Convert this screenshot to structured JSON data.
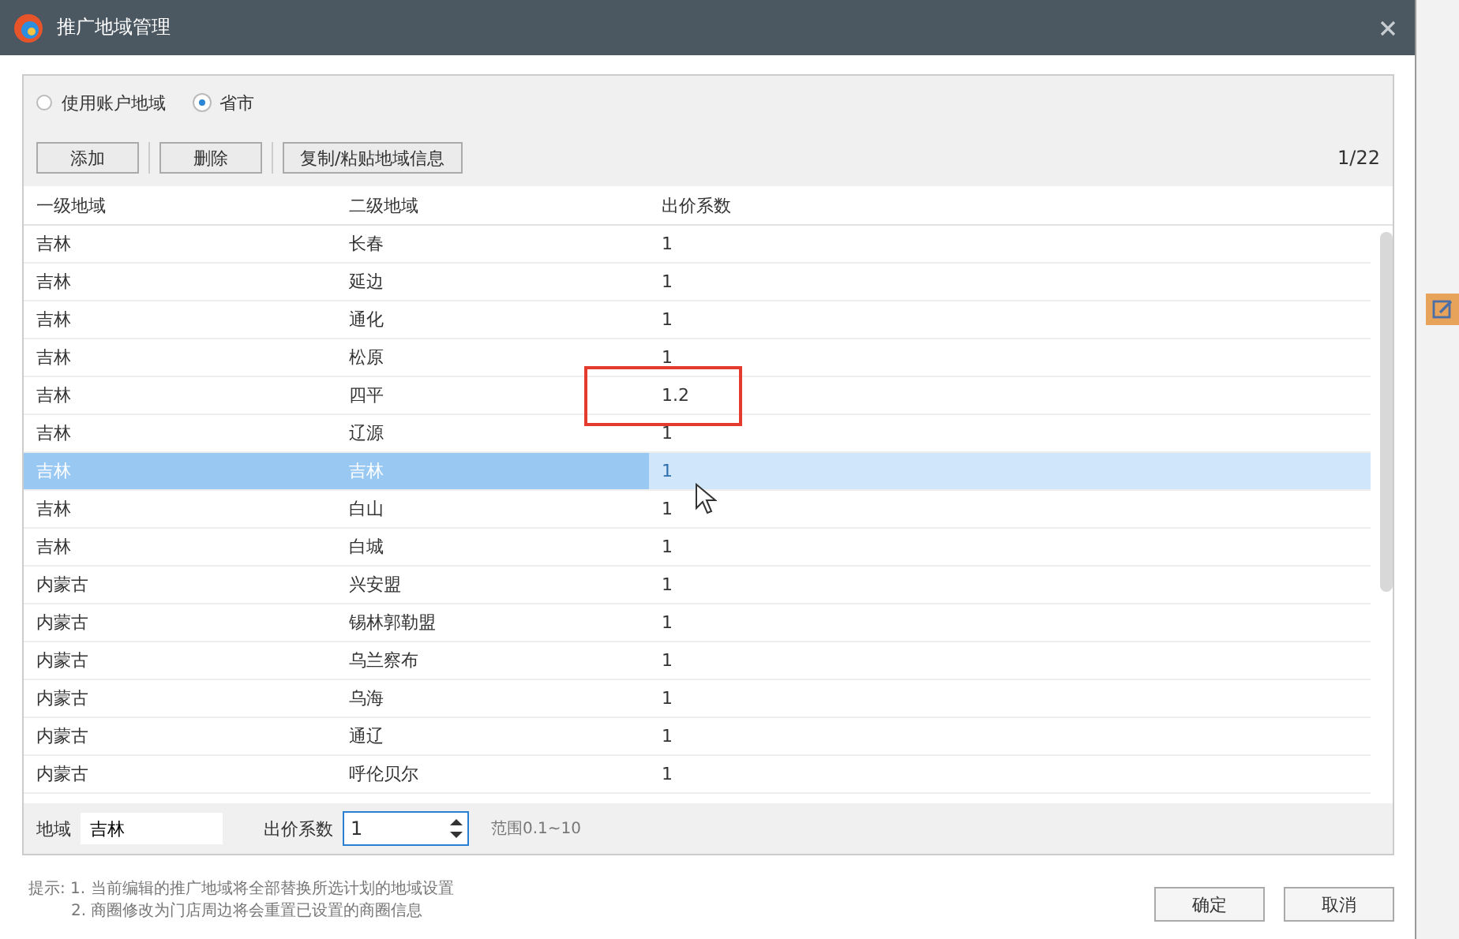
{
  "window": {
    "title": "推广地域管理"
  },
  "scope_options": [
    {
      "label": "使用账户地域",
      "selected": false
    },
    {
      "label": "省市",
      "selected": true
    }
  ],
  "toolbar": {
    "buttons": [
      "添加",
      "删除",
      "复制/粘贴地域信息"
    ],
    "page": "1/22"
  },
  "table": {
    "columns": [
      "一级地域",
      "二级地域",
      "出价系数"
    ],
    "rows": [
      {
        "cells": [
          "吉林",
          "长春",
          "1"
        ],
        "selected": false,
        "highlighted": false
      },
      {
        "cells": [
          "吉林",
          "延边",
          "1"
        ],
        "selected": false,
        "highlighted": false
      },
      {
        "cells": [
          "吉林",
          "通化",
          "1"
        ],
        "selected": false,
        "highlighted": false
      },
      {
        "cells": [
          "吉林",
          "松原",
          "1"
        ],
        "selected": false,
        "highlighted": false
      },
      {
        "cells": [
          "吉林",
          "四平",
          "1.2"
        ],
        "selected": false,
        "highlighted": true
      },
      {
        "cells": [
          "吉林",
          "辽源",
          "1"
        ],
        "selected": false,
        "highlighted": false
      },
      {
        "cells": [
          "吉林",
          "吉林",
          "1"
        ],
        "selected": true,
        "highlighted": false
      },
      {
        "cells": [
          "吉林",
          "白山",
          "1"
        ],
        "selected": false,
        "highlighted": false
      },
      {
        "cells": [
          "吉林",
          "白城",
          "1"
        ],
        "selected": false,
        "highlighted": false
      },
      {
        "cells": [
          "内蒙古",
          "兴安盟",
          "1"
        ],
        "selected": false,
        "highlighted": false
      },
      {
        "cells": [
          "内蒙古",
          "锡林郭勒盟",
          "1"
        ],
        "selected": false,
        "highlighted": false
      },
      {
        "cells": [
          "内蒙古",
          "乌兰察布",
          "1"
        ],
        "selected": false,
        "highlighted": false
      },
      {
        "cells": [
          "内蒙古",
          "乌海",
          "1"
        ],
        "selected": false,
        "highlighted": false
      },
      {
        "cells": [
          "内蒙古",
          "通辽",
          "1"
        ],
        "selected": false,
        "highlighted": false
      },
      {
        "cells": [
          "内蒙古",
          "呼伦贝尔",
          "1"
        ],
        "selected": false,
        "highlighted": false
      }
    ]
  },
  "editor": {
    "region_label": "地域",
    "region_value": "吉林",
    "bid_label": "出价系数",
    "bid_value": "1",
    "range": "范围0.1~10"
  },
  "notes": [
    "提示: 1. 当前编辑的推广地域将全部替换所选计划的地域设置",
    "2. 商圈修改为门店周边将会重置已设置的商圈信息"
  ],
  "buttons": [
    "确定",
    "取消"
  ]
}
